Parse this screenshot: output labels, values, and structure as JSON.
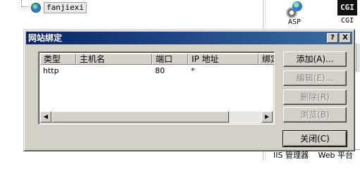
{
  "background": {
    "tree_node_label": "fanjiexi",
    "features": [
      {
        "label": "ASP",
        "icon": "asp-gear-icon"
      },
      {
        "label": "CGI",
        "icon": "cgi-icon",
        "icon_text": "CGI"
      }
    ],
    "bottom_tabs": [
      "IIS 管理器",
      "Web 平台"
    ]
  },
  "dialog": {
    "title": "网站绑定",
    "help_button": "?",
    "close_button": "X",
    "columns": [
      "类型",
      "主机名",
      "端口",
      "IP 地址",
      "绑定"
    ],
    "rows": [
      {
        "type": "http",
        "host": "",
        "port": "80",
        "ip": "*",
        "binding": ""
      }
    ],
    "scroll_left": "◀",
    "scroll_right": "▶",
    "buttons": {
      "add": "添加(A)...",
      "edit": "编辑(E)...",
      "delete": "删除(R)",
      "browse": "浏览(B)",
      "close": "关闭(C)"
    }
  },
  "colors": {
    "titlebar_start": "#0a246a",
    "titlebar_end": "#3a6ea5",
    "dialog_face": "#d4d0c8"
  }
}
